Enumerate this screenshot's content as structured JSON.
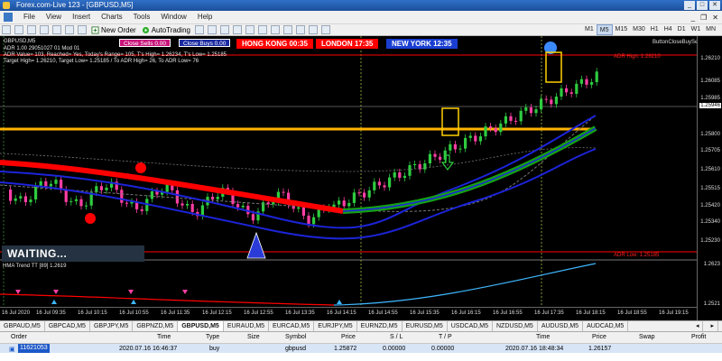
{
  "window": {
    "title": "Forex.com-Live 123 - [GBPUSD,M5]",
    "buttons": [
      "_",
      "□",
      "✕"
    ]
  },
  "menu": {
    "items": [
      "File",
      "View",
      "Insert",
      "Charts",
      "Tools",
      "Window",
      "Help"
    ],
    "mdi_buttons": [
      "_",
      "❐",
      "✕"
    ]
  },
  "toolbar": {
    "new_order": "New Order",
    "autotrading": "AutoTrading",
    "timeframes": [
      "M1",
      "M5",
      "M15",
      "M30",
      "H1",
      "H4",
      "D1",
      "W1",
      "MN"
    ],
    "active_timeframe": "M5"
  },
  "chart": {
    "symbol_line": "GBPUSD,M5",
    "ohlc_line": "ADR 1.00  29051027 01 Mod 01",
    "info_line1": "ADR Value= 103, Reached= Yes, Today's Range= 105, T's High= 1.26234, T's Low= 1.25185",
    "info_line2": "Target High= 1.26210, Target Low= 1.25185 / To ADR High= 26, To ADR Low= 76",
    "close_sells": "Close Sells 0.00",
    "close_buys": "Close Buys 0.00",
    "sessions": [
      {
        "name": "HONG KONG",
        "time": "00:35"
      },
      {
        "name": "LONDON",
        "time": "17:35"
      },
      {
        "name": "NEW YORK",
        "time": "12:35"
      }
    ],
    "button_close": "ButtonCloseBuySell",
    "adr_high_label": "ADR High: 1.26210",
    "adr_low_label": "ADR Low: 1.25185",
    "waiting": "WAITING...",
    "indicator_label": "HMA Trend TT [89] 1.2619",
    "price_ticks": [
      "1.26210",
      "1.26085",
      "1.25985",
      "1.25946",
      "1.25800",
      "1.25705",
      "1.25610",
      "1.25515",
      "1.25420",
      "1.25340",
      "1.25230"
    ],
    "current_price": "1.25946",
    "indicator_ticks": [
      "1.2623",
      "1.2521"
    ],
    "time_ticks": [
      "16 Jul 2020",
      "16 Jul 09:35",
      "16 Jul 10:15",
      "16 Jul 10:55",
      "16 Jul 11:35",
      "16 Jul 12:15",
      "16 Jul 12:55",
      "16 Jul 13:35",
      "16 Jul 14:15",
      "16 Jul 14:55",
      "16 Jul 15:35",
      "16 Jul 16:15",
      "16 Jul 16:55",
      "16 Jul 17:35",
      "16 Jul 18:15",
      "16 Jul 18:55",
      "16 Jul 19:15"
    ],
    "colors": {
      "bull": "#2ecc40",
      "bear": "#ff3fa4",
      "band": "#1c24d8",
      "orange": "#ffb300",
      "red": "#ff0000",
      "green": "#15a015",
      "hma": "#3fb7ff"
    }
  },
  "tabs": [
    "GBPAUD,M5",
    "GBPCAD,M5",
    "GBPJPY,M5",
    "GBPNZD,M5",
    "GBPUSD,M5",
    "EURAUD,M5",
    "EURCAD,M5",
    "EURJPY,M5",
    "EURNZD,M5",
    "EURUSD,M5",
    "USDCAD,M5",
    "NZDUSD,M5",
    "AUDUSD,M5",
    "AUDCAD,M5"
  ],
  "active_tab": "GBPUSD,M5",
  "terminal": {
    "columns": [
      "Order",
      "Time",
      "Type",
      "Size",
      "Symbol",
      "Price",
      "S / L",
      "T / P",
      "Time",
      "Price",
      "Swap",
      "Profit"
    ],
    "row": {
      "order": "11621053",
      "time": "2020.07.16 16:46:37",
      "type": "buy",
      "size": "",
      "symbol": "gbpusd",
      "price": "1.25872",
      "sl": "0.00000",
      "tp": "0.00000",
      "time2": "2020.07.16 18:48:34",
      "price2": "1.26157",
      "swap": "",
      "profit": ""
    }
  }
}
